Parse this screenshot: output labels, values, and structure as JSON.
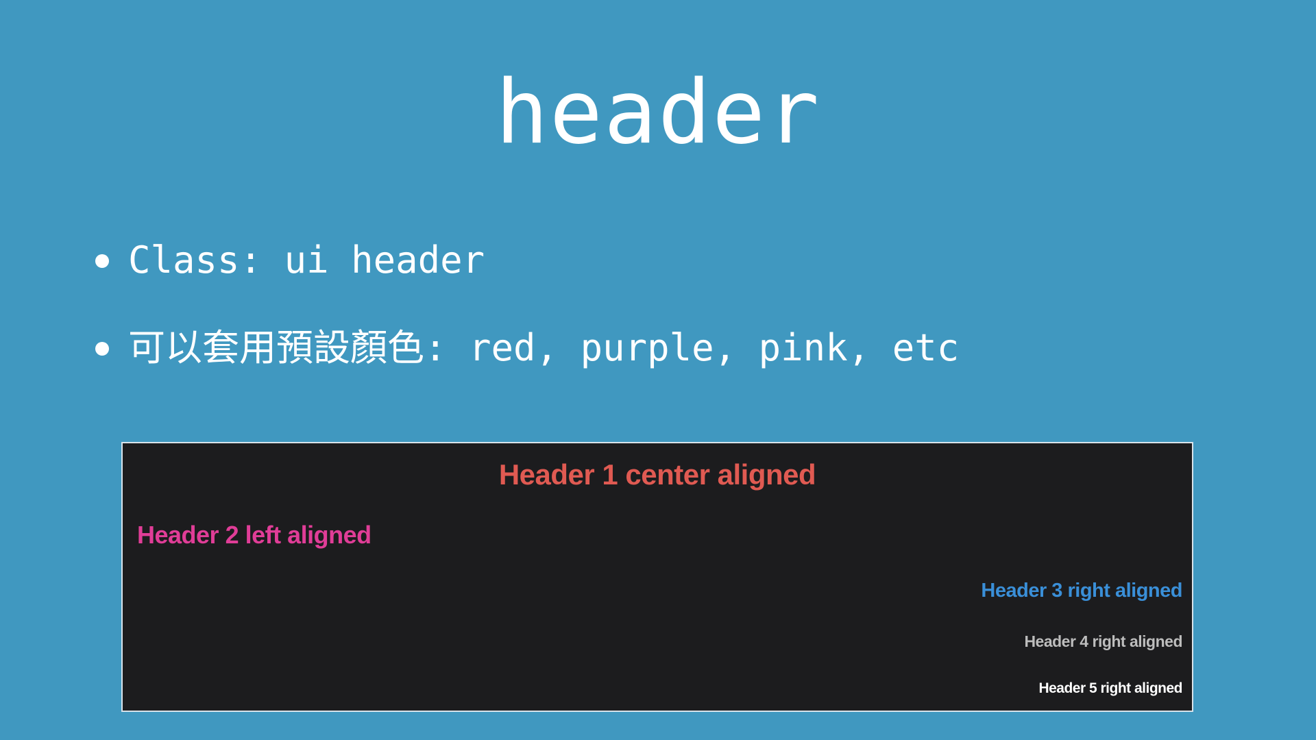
{
  "slide": {
    "title": "header",
    "background_color": "#4098c0"
  },
  "bullets": [
    {
      "text": "Class: ui header"
    },
    {
      "text": "可以套用預設顏色: red, purple, pink, etc"
    }
  ],
  "demo": {
    "panel_background": "#1c1c1e",
    "headers": [
      {
        "text": "Header 1 center aligned",
        "color": "#e05a52",
        "align": "center"
      },
      {
        "text": "Header 2 left aligned",
        "color": "#e03d97",
        "align": "left"
      },
      {
        "text": "Header 3 right aligned",
        "color": "#3a8fd8",
        "align": "right"
      },
      {
        "text": "Header 4 right aligned",
        "color": "#bdbdbd",
        "align": "right"
      },
      {
        "text": "Header 5 right aligned",
        "color": "#ffffff",
        "align": "right"
      }
    ]
  }
}
